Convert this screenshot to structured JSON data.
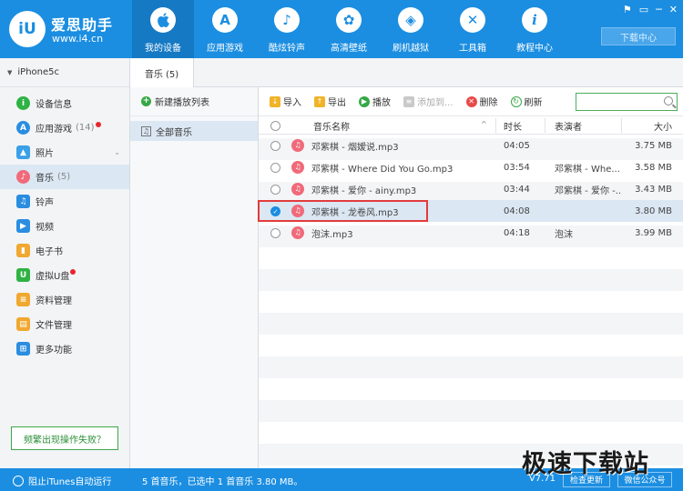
{
  "app": {
    "name": "爱思助手",
    "url": "www.i4.cn",
    "logo_mark": "iU"
  },
  "nav": [
    {
      "label": "我的设备",
      "icon": "apple-icon",
      "glyph": ""
    },
    {
      "label": "应用游戏",
      "icon": "app-store-icon",
      "glyph": "A"
    },
    {
      "label": "酷炫铃声",
      "icon": "bell-icon",
      "glyph": "♪"
    },
    {
      "label": "高清壁纸",
      "icon": "flower-icon",
      "glyph": "✿"
    },
    {
      "label": "刷机越狱",
      "icon": "dropbox-icon",
      "glyph": "◈"
    },
    {
      "label": "工具箱",
      "icon": "tools-icon",
      "glyph": "✕"
    },
    {
      "label": "教程中心",
      "icon": "info-icon",
      "glyph": "i"
    }
  ],
  "window": {
    "controls": [
      "⚑",
      "▭",
      "─",
      "✕"
    ],
    "download_center": "下载中心"
  },
  "device": {
    "name": "iPhone5c"
  },
  "sidebar": {
    "items": [
      {
        "label": "设备信息",
        "count": "",
        "dot": false,
        "icon": "info-icon",
        "color": "#2fb244",
        "glyph": "i"
      },
      {
        "label": "应用游戏",
        "count": "(14)",
        "dot": true,
        "icon": "app-store-icon",
        "color": "#2b8de0",
        "glyph": "A"
      },
      {
        "label": "照片",
        "count": "",
        "dot": false,
        "icon": "photo-icon",
        "color": "#3aa0e8",
        "glyph": "▲",
        "chevron": "⌄"
      },
      {
        "label": "音乐",
        "count": "(5)",
        "dot": false,
        "icon": "music-icon",
        "color": "#f06a7a",
        "glyph": "♪"
      },
      {
        "label": "铃声",
        "count": "",
        "dot": false,
        "icon": "bell-icon",
        "color": "#2b8de0",
        "glyph": "♫"
      },
      {
        "label": "视频",
        "count": "",
        "dot": false,
        "icon": "video-icon",
        "color": "#2b8de0",
        "glyph": "▶"
      },
      {
        "label": "电子书",
        "count": "",
        "dot": false,
        "icon": "book-icon",
        "color": "#f0a830",
        "glyph": "▮"
      },
      {
        "label": "虚拟U盘",
        "count": "",
        "dot": true,
        "icon": "usb-icon",
        "color": "#2fb244",
        "glyph": "U"
      },
      {
        "label": "资料管理",
        "count": "",
        "dot": false,
        "icon": "contacts-icon",
        "color": "#f0a830",
        "glyph": "≡"
      },
      {
        "label": "文件管理",
        "count": "",
        "dot": false,
        "icon": "file-icon",
        "color": "#f0a830",
        "glyph": "▤"
      },
      {
        "label": "更多功能",
        "count": "",
        "dot": false,
        "icon": "grid-icon",
        "color": "#2b8de0",
        "glyph": "⊞"
      }
    ],
    "active_index": 3,
    "help_button": "频繁出现操作失败？"
  },
  "tabs": [
    {
      "label": "音乐 (5)"
    }
  ],
  "playlists": {
    "new_label": "新建播放列表",
    "plus_glyph": "+",
    "note_glyph": "♫",
    "items": [
      {
        "label": "全部音乐"
      }
    ]
  },
  "toolbar": {
    "import": "导入",
    "export": "导出",
    "play": "播放",
    "add_to": "添加到...",
    "delete": "删除",
    "refresh": "刷新",
    "search_placeholder": ""
  },
  "table": {
    "headers": {
      "name": "音乐名称",
      "duration": "时长",
      "artist": "表演者",
      "size": "大小"
    },
    "sort_glyph": "^",
    "check_glyph": "✓",
    "music_glyph": "♫",
    "rows": [
      {
        "name": "邓紫棋 - 烟嫒说.mp3",
        "duration": "04:05",
        "artist": "",
        "size": "3.75 MB",
        "checked": false
      },
      {
        "name": "邓紫棋 - Where Did You Go.mp3",
        "duration": "03:54",
        "artist": "邓紫棋 - Whe...",
        "size": "3.58 MB",
        "checked": false
      },
      {
        "name": "邓紫棋 - 爱你 - ainy.mp3",
        "duration": "03:44",
        "artist": "邓紫棋 - 爱你 -...",
        "size": "3.43 MB",
        "checked": false
      },
      {
        "name": "邓紫棋 - 龙卷风.mp3",
        "duration": "04:08",
        "artist": "",
        "size": "3.80 MB",
        "checked": true
      },
      {
        "name": "泡沫.mp3",
        "duration": "04:18",
        "artist": "泡沫",
        "size": "3.99 MB",
        "checked": false
      }
    ]
  },
  "status": {
    "itunes_label": "阻止iTunes自动运行",
    "summary": "5 首音乐，已选中 1 首音乐 3.80 MB。",
    "version": "V7.71",
    "check_update": "检查更新",
    "wechat": "微信公众号"
  },
  "watermark": "极速下载站",
  "colors": {
    "brand_blue": "#1b8ee1",
    "selected_row": "#dbe7f3",
    "highlight_red": "#e23b3b",
    "music_pink": "#f06a7a"
  }
}
